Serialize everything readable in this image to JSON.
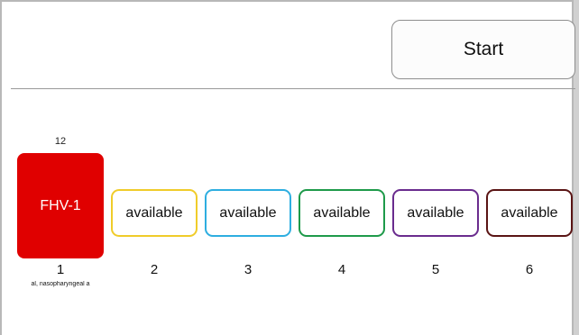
{
  "toolbar": {
    "start_label": "Start"
  },
  "slots": [
    {
      "number": "1",
      "count": "12",
      "label": "FHV-1",
      "description": "al, nasopharyngeal a",
      "color": "#e00000",
      "filled": true
    },
    {
      "number": "2",
      "label": "available",
      "color": "#f0cc2a",
      "filled": false
    },
    {
      "number": "3",
      "label": "available",
      "color": "#2eaee0",
      "filled": false
    },
    {
      "number": "4",
      "label": "available",
      "color": "#1e9a4a",
      "filled": false
    },
    {
      "number": "5",
      "label": "available",
      "color": "#6a2c8e",
      "filled": false
    },
    {
      "number": "6",
      "label": "available",
      "color": "#5a1414",
      "filled": false
    }
  ]
}
